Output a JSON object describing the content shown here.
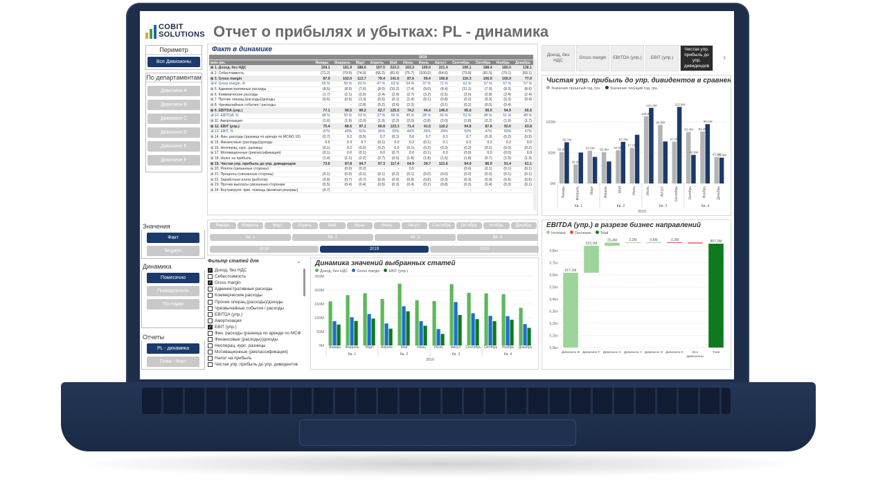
{
  "app": {
    "logo_line1": "COBIT",
    "logo_line2": "SOLUTIONS",
    "title": "Отчет о прибылях и убытках: PL - динамика"
  },
  "perimeter": {
    "header": "Периметр",
    "button": "Все Дивизионы"
  },
  "departments": {
    "header": "По департаментам",
    "items": [
      "Дивизион А",
      "Дивизион B",
      "Дивизион C",
      "Дивизион D",
      "Дивизион E",
      "Дивизион F"
    ]
  },
  "values_box": {
    "header": "Значения",
    "items": [
      "Факт",
      "Бюджет"
    ],
    "active": 0
  },
  "dynamics_box": {
    "header": "Динамика",
    "items": [
      "Помесячно",
      "Поквартально",
      "По годам"
    ],
    "active": 0
  },
  "reports_box": {
    "header": "Отчеты",
    "items": [
      "PL - динамика",
      "План - Факт"
    ],
    "active": 0
  },
  "fact_table": {
    "title": "Факт в динамике",
    "year": "2019",
    "unit": "млн грн.",
    "months": [
      "Январь",
      "Февраль",
      "Март",
      "Апрель",
      "Май",
      "Июнь",
      "Июль",
      "Август",
      "Сентябрь",
      "Октябрь",
      "Ноябрь",
      "Декабрь"
    ],
    "rows": [
      {
        "name": "1. Доход, без НДС",
        "style": "b",
        "v": [
          "159.1",
          "181.9",
          "188.6",
          "167.5",
          "223.2",
          "163.3",
          "160.0",
          "221.4",
          "190.1",
          "188.4",
          "185.0",
          "136.1"
        ]
      },
      {
        "name": "2. Себестоимость",
        "style": "",
        "v": [
          "(71.2)",
          "(79.9)",
          "(74.9)",
          "(66.2)",
          "(81.6)",
          "(75.7)",
          "(100.6)",
          "(64.6)",
          "(73.8)",
          "(81.5)",
          "(79.1)",
          "(59.1)"
        ]
      },
      {
        "name": "3. Gross margin",
        "style": "b",
        "v": [
          "87.9",
          "102.0",
          "113.7",
          "79.4",
          "141.6",
          "87.6",
          "59.4",
          "156.8",
          "116.3",
          "106.9",
          "105.9",
          "77.0"
        ]
      },
      {
        "name": "4. Gross margin, %",
        "style": "p",
        "v": [
          "55 %",
          "56 %",
          "60 %",
          "47 %",
          "63 %",
          "54 %",
          "37 %",
          "71 %",
          "61 %",
          "57 %",
          "57 %",
          "57 %"
        ]
      },
      {
        "name": "5. Административные расходы",
        "style": "",
        "v": [
          "(8.5)",
          "(8.9)",
          "(7.6)",
          "(8.0)",
          "(10.2)",
          "(7.4)",
          "(9.0)",
          "(8.4)",
          "(11.1)",
          "(7.9)",
          "(8.3)",
          "(8.6)"
        ]
      },
      {
        "name": "6. Коммерческие расходы",
        "style": "",
        "v": [
          "(1.7)",
          "(2.1)",
          "(2.0)",
          "(2.4)",
          "(2.9)",
          "(2.7)",
          "(3.2)",
          "(2.5)",
          "(3.0)",
          "(2.8)",
          "(2.4)",
          "(2.4)"
        ]
      },
      {
        "name": "7. Прочие операц.(расходы)/доходы",
        "style": "",
        "v": [
          "(0.6)",
          "(0.5)",
          "(1.3)",
          "(0.5)",
          "(0.1)",
          "(1.4)",
          "(0.1)",
          "(0.8)",
          "(0.2)",
          "(0.3)",
          "(0.3)",
          "(0.4)"
        ]
      },
      {
        "name": "8. Чрезвычайные события / расходы",
        "style": "",
        "v": [
          "-",
          "-",
          "(2.8)",
          "(5.2)",
          "(0.6)",
          "(2.3)",
          "-",
          "(0.1)",
          "(0.2)",
          "(0.5)",
          "(0.4)",
          "-"
        ]
      },
      {
        "name": "9. EBITDA (упр.)",
        "style": "b",
        "v": [
          "77.1",
          "90.5",
          "99.2",
          "62.7",
          "125.5",
          "74.2",
          "44.4",
          "146.0",
          "96.6",
          "90.0",
          "94.9",
          "65.5"
        ]
      },
      {
        "name": "10. EBITDA, %",
        "style": "p",
        "v": [
          "48 %",
          "50 %",
          "53 %",
          "37 %",
          "56 %",
          "45 %",
          "28 %",
          "66 %",
          "51 %",
          "48 %",
          "51 %",
          "48 %"
        ]
      },
      {
        "name": "11. Амортизация",
        "style": "",
        "v": [
          "(1.6)",
          "(1.9)",
          "(2.0)",
          "(1.9)",
          "(2.2)",
          "(2.0)",
          "(2.8)",
          "(2.0)",
          "(1.8)",
          "(2.2)",
          "(1.9)",
          "(1.7)"
        ]
      },
      {
        "name": "12. EBIT (упр.)",
        "style": "b",
        "v": [
          "75.4",
          "88.6",
          "97.1",
          "60.8",
          "123.3",
          "71.4",
          "41.6",
          "110.2",
          "94.8",
          "87.8",
          "93.0",
          "63.8"
        ]
      },
      {
        "name": "13. EBIT, %",
        "style": "p",
        "v": [
          "47%",
          "49%",
          "51%",
          "36%",
          "55%",
          "44%",
          "26%",
          "29%",
          "50%",
          "47%",
          "50%",
          "47%"
        ]
      },
      {
        "name": "14. Фин. расходы (разница по аренде по МСФО 16)",
        "style": "",
        "v": [
          "(0.7)",
          "0.2",
          "(0.5)",
          "0.7",
          "(0.1)",
          "0.6",
          "0.7",
          "0.1",
          "0.7",
          "(0.3)",
          "(0.2)",
          "(0.5)"
        ]
      },
      {
        "name": "15. Финансовые (расходы)/доходы",
        "style": "",
        "v": [
          "0.5",
          "0.3",
          "0.7",
          "(0.1)",
          "0.0",
          "0.2",
          "(0.1)",
          "0.1",
          "0.2",
          "0.2",
          "0.2",
          "0.0"
        ]
      },
      {
        "name": "16. Неоперац. курс. разницы",
        "style": "",
        "v": [
          "(0.1)",
          "0.2",
          "(0.0)",
          "(0.2)",
          "0.0",
          "(0.1)",
          "(0.2)",
          "(0.3)",
          "(0.2)",
          "(0.1)",
          "(0.0)",
          "(0.2)"
        ]
      },
      {
        "name": "17. Мотивационные (реклассификация)",
        "style": "",
        "v": [
          "(0.1)",
          "0.0",
          "(0.1)",
          "0.0",
          "(0.7)",
          "0.0",
          "(0.1)",
          "0.0",
          "(0.0)",
          "0.0",
          "(0.0)",
          "0.0"
        ]
      },
      {
        "name": "18. Налог на прибыль",
        "style": "",
        "v": [
          "(1.4)",
          "(1.1)",
          "(2.2)",
          "(2.7)",
          "(0.5)",
          "(1.8)",
          "(1.8)",
          "(1.5)",
          "(1.8)",
          "(0.7)",
          "(1.3)",
          "(1.3)"
        ]
      },
      {
        "name": "19. Чистая упр. прибыль до упр. дивидендов",
        "style": "b",
        "v": [
          "73.6",
          "87.8",
          "94.7",
          "57.3",
          "117.4",
          "64.9",
          "39.7",
          "121.6",
          "94.9",
          "86.9",
          "91.4",
          "61.1"
        ]
      },
      {
        "name": "20. Роялти (связанные стороны)",
        "style": "",
        "v": [
          "-",
          "(0.0)",
          "(0.2)",
          "-",
          "-",
          "0.5",
          "-",
          "-",
          "(0.6)",
          "(0.1)",
          "(0.1)",
          "(0.1)"
        ]
      },
      {
        "name": "21. Проценты (связанные стороны)",
        "style": "",
        "v": [
          "(0.1)",
          "(0.0)",
          "(0.1)",
          "(0.1)",
          "(0.2)",
          "(0.1)",
          "(0.0)",
          "(0.0)",
          "(0.2)",
          "(0.0)",
          "(0.1)",
          "(0.1)"
        ]
      },
      {
        "name": "22. Заработная плата (роботов)",
        "style": "",
        "v": [
          "(0.8)",
          "(0.7)",
          "(0.7)",
          "(0.9)",
          "(0.6)",
          "(0.8)",
          "(0.8)",
          "(0.3)",
          "(0.3)",
          "(0.9)",
          "(0.6)",
          "(0.6)"
        ]
      },
      {
        "name": "23. Прочие выплаты связанным сторонам",
        "style": "",
        "v": [
          "(0.5)",
          "(0.4)",
          "(0.4)",
          "(0.5)",
          "(0.3)",
          "(0.4)",
          "(0.2)",
          "(0.8)",
          "(0.3)",
          "(0.4)",
          "(0.3)",
          "(0.1)"
        ]
      },
      {
        "name": "24. Внутригрупп. фин. помощь (включая резервы)",
        "style": "",
        "v": [
          "(0.7)",
          "-",
          "-",
          "-",
          "-",
          "-",
          "-",
          "-",
          "-",
          "-",
          "-",
          "-"
        ]
      }
    ]
  },
  "period_slicer": {
    "months": [
      "Январь",
      "Февраль",
      "Март",
      "Апрель",
      "Май",
      "Июнь",
      "Июль",
      "Август",
      "Сентябрь",
      "Октябрь",
      "Ноябрь",
      "Декабрь"
    ],
    "quarters": [
      "Кв. 1",
      "Кв. 2",
      "Кв. 3",
      "Кв. 4"
    ],
    "years": [
      "2018",
      "2019",
      "2020"
    ],
    "active_year": "2019"
  },
  "filter": {
    "title": "Фильтр статей для",
    "items": [
      {
        "label": "Доход, без НДС",
        "checked": true
      },
      {
        "label": "Себестоимость",
        "checked": false
      },
      {
        "label": "Gross margin",
        "checked": true
      },
      {
        "label": "Административные расходы",
        "checked": false
      },
      {
        "label": "Коммерческие расходы",
        "checked": false
      },
      {
        "label": "Прочие операц.(расходы)/доходы",
        "checked": false
      },
      {
        "label": "Чрезвычайные события / расходы",
        "checked": false
      },
      {
        "label": "EBITDA (упр.)",
        "checked": false
      },
      {
        "label": "Амортизация",
        "checked": false
      },
      {
        "label": "EBIT (упр.)",
        "checked": true
      },
      {
        "label": "Фин. расходы (разница по аренде по МСФ",
        "checked": false
      },
      {
        "label": "Финансовые (расходы)/доходы",
        "checked": false
      },
      {
        "label": "Неоперац. курс. разницы",
        "checked": false
      },
      {
        "label": "Мотивационные (реклассификация)",
        "checked": false
      },
      {
        "label": "Налог на прибыль",
        "checked": false
      },
      {
        "label": "Чистая упр. прибыль до упр. дивидентов",
        "checked": false
      }
    ]
  },
  "tiles": {
    "items": [
      "Доход, без НДС",
      "Gross margin",
      "EBITDA (упр.)",
      "EBIT (упр.)",
      "Чистая упр. прибыль до упр. дивидендов"
    ],
    "active": 4
  },
  "colors": {
    "navy": "#1b3a6b",
    "gray": "#b4b4b4",
    "green": "#5cb85c",
    "blue": "#1f6fd1",
    "dgreen": "#0e7a1e",
    "light_green": "#9ed49a"
  },
  "chart_data": [
    {
      "id": "net-profit-compare",
      "type": "bar",
      "title": "Чистая упр. прибыль до упр. дивидентов в сравнении с прош",
      "series": [
        {
          "name": "Значение прошлый год, грн.",
          "values": [
            50.9,
            30.9,
            53.0,
            50.8,
            53.8,
            57.6,
            108.8,
            94.8,
            67.8,
            83.4,
            84.2,
            43.0
          ]
        },
        {
          "name": "Значение текущий год, грн.",
          "values": [
            66.7,
            50.0,
            43.0,
            35.6,
            67.4,
            78.8,
            122.4,
            68.0,
            123.9,
            46.3,
            96.1,
            41.8
          ]
        }
      ],
      "value_labels": {
        "prev": [
          "50.9M",
          "30.9M",
          "53.0M",
          "50.8M",
          "53.8M",
          "57.6M",
          "108.8M",
          "94.8M",
          "67.8M",
          "83.4M",
          "84.2M",
          "43.0M"
        ],
        "cur": [
          "66.7M",
          "",
          "",
          "",
          "67.4M",
          "",
          "122.4M",
          "",
          "123.9M",
          "46.3M",
          "96.1M",
          "41.8M"
        ]
      },
      "categories": [
        "Январь",
        "Февраль",
        "Март",
        "Апрель",
        "Май",
        "Июнь",
        "Июль",
        "Август",
        "Сентябрь",
        "Октябрь",
        "Ноябрь",
        "Декабрь"
      ],
      "groups": [
        "Кв. 1",
        "Кв. 2",
        "Кв. 3",
        "Кв. 4"
      ],
      "year": "2019",
      "yticks": [
        "100M",
        "50M",
        "0M"
      ],
      "ylim": [
        0,
        130
      ]
    },
    {
      "id": "selected-items-dynamics",
      "type": "bar",
      "title": "Динамика значений выбранных статей",
      "series": [
        {
          "name": "Доход, без НДС",
          "values": [
            159.1,
            181.9,
            188.6,
            167.5,
            223.2,
            163.3,
            160.0,
            221.4,
            190.1,
            188.4,
            185.0,
            136.1
          ]
        },
        {
          "name": "Gross margin",
          "values": [
            87.9,
            102.0,
            113.7,
            79.4,
            141.6,
            87.6,
            59.4,
            156.8,
            116.3,
            106.9,
            105.9,
            77.0
          ]
        },
        {
          "name": "EBIT (упр.)",
          "values": [
            75.4,
            88.6,
            97.1,
            60.8,
            123.3,
            71.4,
            41.6,
            110.2,
            94.8,
            87.8,
            93.0,
            63.8
          ]
        }
      ],
      "categories": [
        "Январь",
        "Февраль",
        "Март",
        "Апрель",
        "Май",
        "Июнь",
        "Июль",
        "Август",
        "Сентябрь",
        "Октябрь",
        "Ноябрь",
        "Декабрь"
      ],
      "groups": [
        "Кв. 1",
        "Кв. 2",
        "Кв. 3",
        "Кв. 4"
      ],
      "year": "2019",
      "yticks": [
        "250M",
        "200M",
        "150M",
        "100M",
        "50M",
        "0M"
      ],
      "ylim": [
        0,
        250
      ]
    },
    {
      "id": "ebitda-waterfall",
      "type": "bar",
      "subtype": "waterfall",
      "title": "EBITDA (упр.) в разрезе бизнес направлений",
      "legend": [
        "Increase",
        "Decrease",
        "Total"
      ],
      "categories": [
        "Дивизион B",
        "Дивизион F",
        "Дивизион C",
        "Дивизион A",
        "Дивизион D",
        "Дивизион E",
        "Все Дивизионы",
        "Total"
      ],
      "deltas": [
        617.1,
        223.1,
        25.4,
        2.2,
        0.6,
        -1.2,
        -8.0,
        857.2
      ],
      "value_labels": [
        "617,1М",
        "223,1М",
        "25,4М",
        "2,2М",
        "0,6М",
        "-1,2М",
        "",
        "857,2М"
      ],
      "yticks": [
        "0,0bn",
        "0,1bn",
        "0,2bn",
        "0,3bn",
        "0,4bn",
        "0,5bn",
        "0,6bn",
        "0,7bn",
        "0,8bn"
      ],
      "ylim": [
        0,
        880
      ]
    }
  ]
}
